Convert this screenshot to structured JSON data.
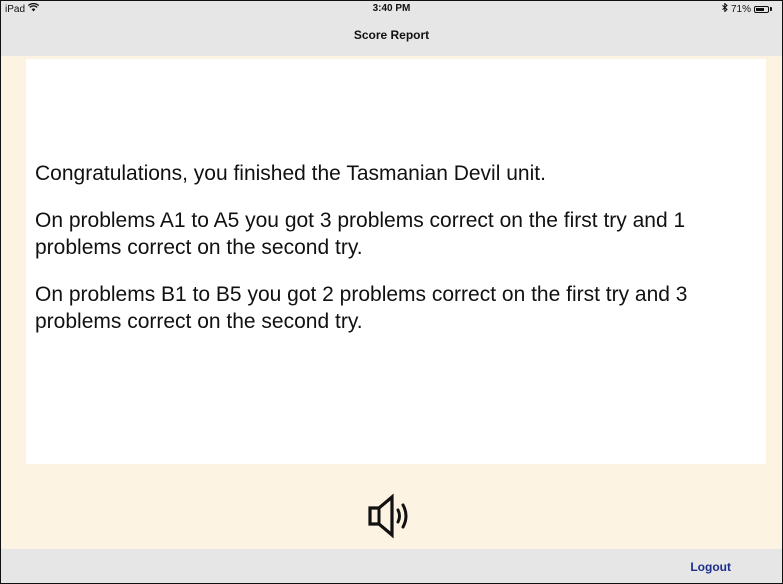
{
  "status_bar": {
    "device": "iPad",
    "time": "3:40 PM",
    "battery": "71%",
    "battery_level": 0.71,
    "wifi_icon": "wifi-icon",
    "bluetooth_icon": "bluetooth-icon"
  },
  "header": {
    "title": "Score Report"
  },
  "report": {
    "paragraphs": [
      "Congratulations, you finished the Tasmanian Devil unit.",
      "On problems A1 to A5 you got 3 problems correct on the first try and 1 problems correct on the second try.",
      "On problems B1 to B5 you got 2 problems correct on the first try and 3 problems correct on the second try."
    ]
  },
  "audio": {
    "icon": "speaker-icon"
  },
  "footer": {
    "logout_label": "Logout"
  },
  "colors": {
    "background": "#fdf3e2",
    "bars": "#e6e6e6",
    "card": "#ffffff",
    "link": "#1b2e8c"
  }
}
